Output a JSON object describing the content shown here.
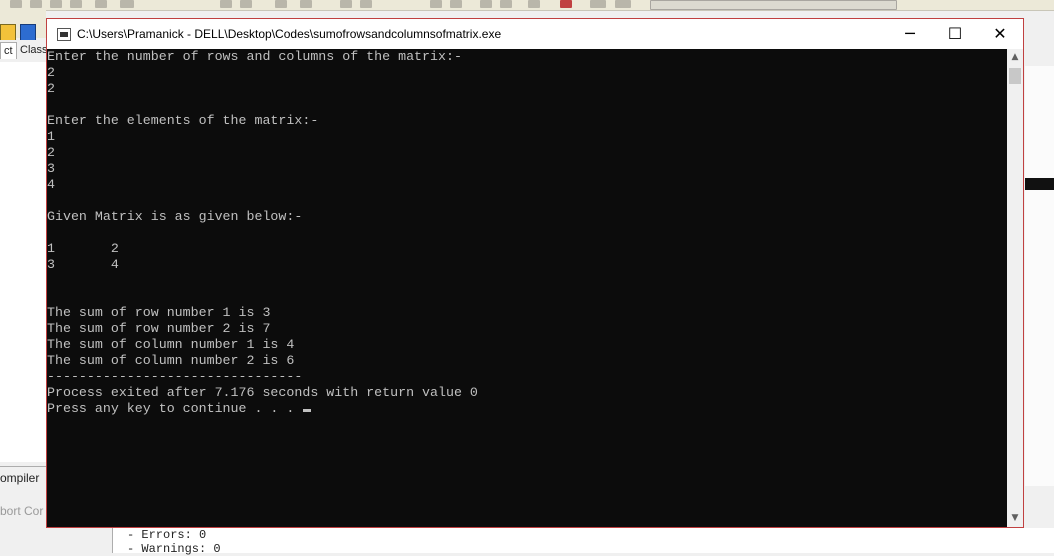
{
  "ide": {
    "tab_project": "ct",
    "tab_classes": "Class",
    "compiler_tab": "ompiler",
    "abort_button": "bort Cor",
    "log_errors": "- Errors: 0",
    "log_warnings": "- Warnings: 0"
  },
  "window": {
    "title": "C:\\Users\\Pramanick - DELL\\Desktop\\Codes\\sumofrowsandcolumnsofmatrix.exe",
    "minimize_glyph": "─",
    "maximize_glyph": "☐",
    "close_glyph": "✕"
  },
  "console": {
    "lines": [
      "Enter the number of rows and columns of the matrix:-",
      "2",
      "2",
      "",
      "Enter the elements of the matrix:-",
      "1",
      "2",
      "3",
      "4",
      "",
      "Given Matrix is as given below:-",
      "",
      "1       2",
      "3       4",
      "",
      "",
      "The sum of row number 1 is 3",
      "The sum of row number 2 is 7",
      "The sum of column number 1 is 4",
      "The sum of column number 2 is 6",
      "--------------------------------",
      "Process exited after 7.176 seconds with return value 0",
      "Press any key to continue . . . "
    ]
  },
  "scrollbar": {
    "up_glyph": "▲",
    "down_glyph": "▼"
  }
}
